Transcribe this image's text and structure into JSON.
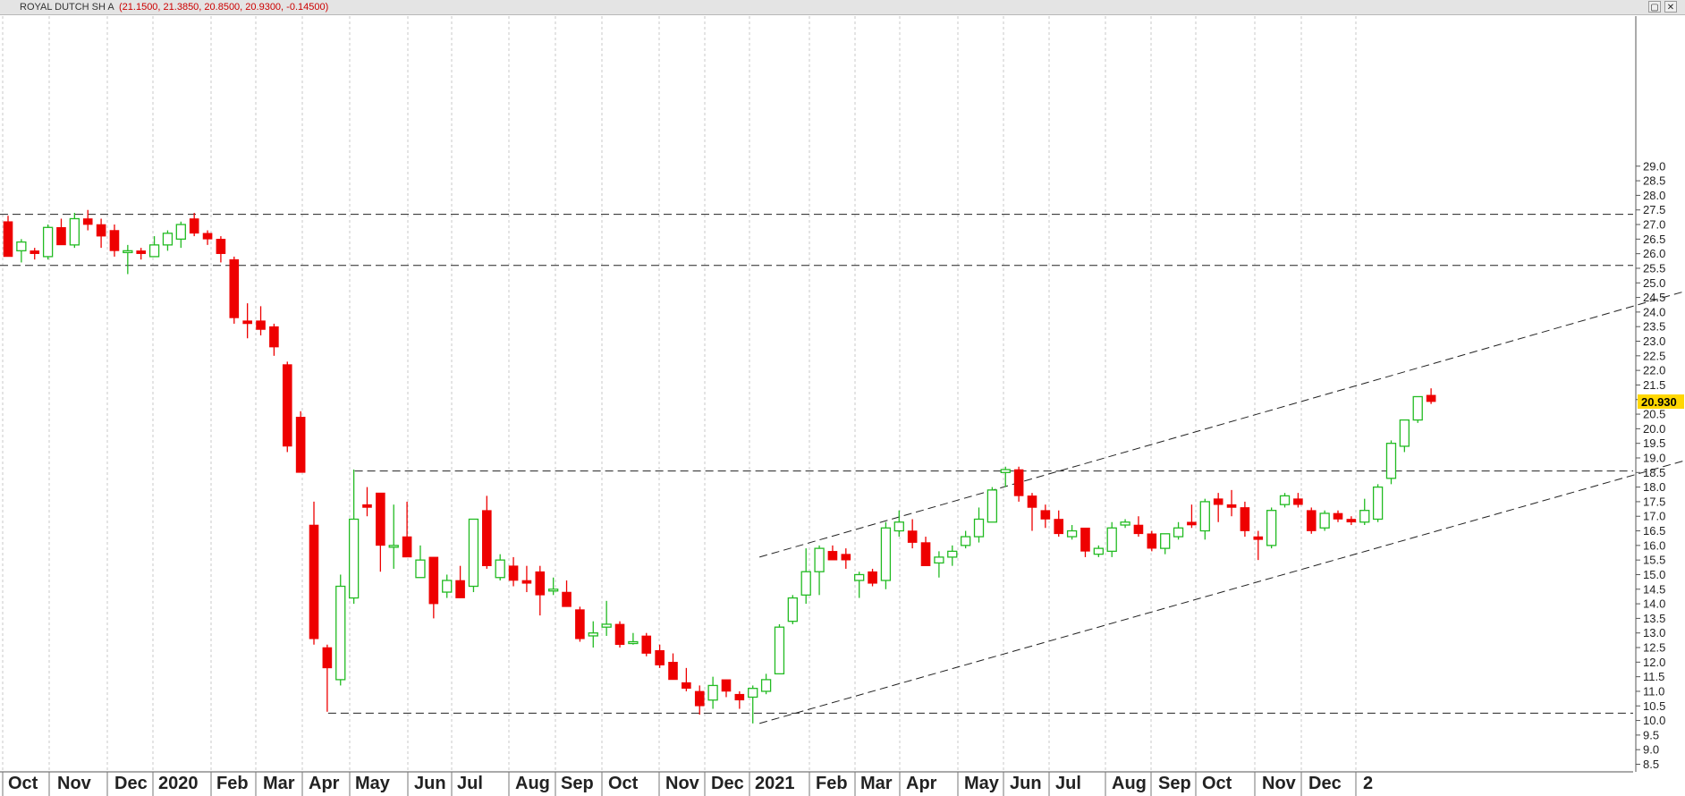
{
  "header": {
    "symbol": "ROYAL DUTCH SH A",
    "ohlc_text": "(21.1500, 21.3850, 20.8500, 20.9300, -0.14500)",
    "restore_icon": "restore-icon",
    "close_icon": "close-icon",
    "restore_glyph": "▢",
    "close_glyph": "✕"
  },
  "colors": {
    "up": "#22bb22",
    "down": "#ee0000",
    "grid": "#c8c8c8",
    "trendline": "#222222",
    "last_price_bg": "#ffd700"
  },
  "chart_data": {
    "type": "candlestick",
    "title": "ROYAL DUTCH SH A",
    "interval": "weekly",
    "ylim": [
      8.25,
      29.25
    ],
    "y_ticks": [
      "29.0",
      "28.5",
      "28.0",
      "27.5",
      "27.0",
      "26.5",
      "26.0",
      "25.5",
      "25.0",
      "24.5",
      "24.0",
      "23.5",
      "23.0",
      "22.5",
      "22.0",
      "21.5",
      "21.0",
      "20.5",
      "20.0",
      "19.5",
      "19.0",
      "18.5",
      "18.0",
      "17.5",
      "17.0",
      "16.5",
      "16.0",
      "15.5",
      "15.0",
      "14.5",
      "14.0",
      "13.5",
      "13.0",
      "12.5",
      "12.0",
      "11.5",
      "11.0",
      "10.5",
      "10.0",
      "9.5",
      "9.0",
      "8.5"
    ],
    "x_labels": [
      "Oct",
      "Nov",
      "Dec",
      "2020",
      "Feb",
      "Mar",
      "Apr",
      "May",
      "Jun",
      "Jul",
      "Aug",
      "Sep",
      "Oct",
      "Nov",
      "Dec",
      "2021",
      "Feb",
      "Mar",
      "Apr",
      "May",
      "Jun",
      "Jul",
      "Aug",
      "Sep",
      "Oct",
      "Nov",
      "Dec",
      "2"
    ],
    "last_price_label": "20.930",
    "grid": true,
    "candles": [
      {
        "o": 27.1,
        "h": 27.3,
        "l": 25.9,
        "c": 25.9
      },
      {
        "o": 26.1,
        "h": 26.5,
        "l": 25.7,
        "c": 26.4
      },
      {
        "o": 26.1,
        "h": 26.2,
        "l": 25.8,
        "c": 26.0
      },
      {
        "o": 25.9,
        "h": 27.0,
        "l": 25.8,
        "c": 26.9
      },
      {
        "o": 26.9,
        "h": 27.2,
        "l": 26.3,
        "c": 26.3
      },
      {
        "o": 26.3,
        "h": 27.4,
        "l": 26.2,
        "c": 27.2
      },
      {
        "o": 27.2,
        "h": 27.5,
        "l": 26.8,
        "c": 27.0
      },
      {
        "o": 27.0,
        "h": 27.2,
        "l": 26.2,
        "c": 26.6
      },
      {
        "o": 26.8,
        "h": 27.0,
        "l": 25.9,
        "c": 26.1
      },
      {
        "o": 26.1,
        "h": 26.3,
        "l": 25.3,
        "c": 26.1
      },
      {
        "o": 26.1,
        "h": 26.2,
        "l": 25.8,
        "c": 26.0
      },
      {
        "o": 25.9,
        "h": 26.6,
        "l": 25.9,
        "c": 26.3
      },
      {
        "o": 26.3,
        "h": 26.8,
        "l": 26.1,
        "c": 26.7
      },
      {
        "o": 26.5,
        "h": 27.1,
        "l": 26.2,
        "c": 27.0
      },
      {
        "o": 27.2,
        "h": 27.4,
        "l": 26.6,
        "c": 26.7
      },
      {
        "o": 26.7,
        "h": 26.8,
        "l": 26.3,
        "c": 26.5
      },
      {
        "o": 26.5,
        "h": 26.6,
        "l": 25.7,
        "c": 26.0
      },
      {
        "o": 25.8,
        "h": 25.9,
        "l": 23.6,
        "c": 23.8
      },
      {
        "o": 23.7,
        "h": 24.3,
        "l": 23.1,
        "c": 23.6
      },
      {
        "o": 23.7,
        "h": 24.2,
        "l": 23.2,
        "c": 23.4
      },
      {
        "o": 23.5,
        "h": 23.6,
        "l": 22.5,
        "c": 22.8
      },
      {
        "o": 22.2,
        "h": 22.3,
        "l": 19.2,
        "c": 19.4
      },
      {
        "o": 20.4,
        "h": 20.6,
        "l": 18.5,
        "c": 18.5
      },
      {
        "o": 16.7,
        "h": 17.5,
        "l": 12.6,
        "c": 12.8
      },
      {
        "o": 12.5,
        "h": 12.6,
        "l": 10.3,
        "c": 11.8
      },
      {
        "o": 11.4,
        "h": 15.0,
        "l": 11.2,
        "c": 14.6
      },
      {
        "o": 14.2,
        "h": 18.6,
        "l": 14.0,
        "c": 16.9
      },
      {
        "o": 17.4,
        "h": 18.0,
        "l": 17.0,
        "c": 17.3
      },
      {
        "o": 17.8,
        "h": 17.8,
        "l": 15.1,
        "c": 16.0
      },
      {
        "o": 16.0,
        "h": 17.4,
        "l": 15.2,
        "c": 16.0
      },
      {
        "o": 16.3,
        "h": 17.5,
        "l": 15.6,
        "c": 15.6
      },
      {
        "o": 14.9,
        "h": 16.0,
        "l": 14.9,
        "c": 15.5
      },
      {
        "o": 15.6,
        "h": 15.6,
        "l": 13.5,
        "c": 14.0
      },
      {
        "o": 14.4,
        "h": 15.0,
        "l": 14.2,
        "c": 14.8
      },
      {
        "o": 14.8,
        "h": 15.3,
        "l": 14.2,
        "c": 14.2
      },
      {
        "o": 14.6,
        "h": 16.9,
        "l": 14.4,
        "c": 16.9
      },
      {
        "o": 17.2,
        "h": 17.7,
        "l": 15.2,
        "c": 15.3
      },
      {
        "o": 14.9,
        "h": 15.7,
        "l": 14.8,
        "c": 15.5
      },
      {
        "o": 15.3,
        "h": 15.6,
        "l": 14.6,
        "c": 14.8
      },
      {
        "o": 14.8,
        "h": 15.3,
        "l": 14.4,
        "c": 14.7
      },
      {
        "o": 15.1,
        "h": 15.3,
        "l": 13.6,
        "c": 14.3
      },
      {
        "o": 14.5,
        "h": 14.9,
        "l": 14.3,
        "c": 14.5
      },
      {
        "o": 14.4,
        "h": 14.8,
        "l": 13.9,
        "c": 13.9
      },
      {
        "o": 13.8,
        "h": 13.9,
        "l": 12.7,
        "c": 12.8
      },
      {
        "o": 12.9,
        "h": 13.4,
        "l": 12.5,
        "c": 13.0
      },
      {
        "o": 13.2,
        "h": 14.1,
        "l": 12.9,
        "c": 13.3
      },
      {
        "o": 13.3,
        "h": 13.4,
        "l": 12.5,
        "c": 12.6
      },
      {
        "o": 12.7,
        "h": 13.0,
        "l": 12.6,
        "c": 12.7
      },
      {
        "o": 12.9,
        "h": 13.0,
        "l": 12.2,
        "c": 12.3
      },
      {
        "o": 12.4,
        "h": 12.6,
        "l": 11.8,
        "c": 11.9
      },
      {
        "o": 12.0,
        "h": 12.3,
        "l": 11.4,
        "c": 11.4
      },
      {
        "o": 11.3,
        "h": 11.8,
        "l": 11.0,
        "c": 11.1
      },
      {
        "o": 11.0,
        "h": 11.2,
        "l": 10.2,
        "c": 10.5
      },
      {
        "o": 10.7,
        "h": 11.5,
        "l": 10.4,
        "c": 11.2
      },
      {
        "o": 11.4,
        "h": 11.4,
        "l": 10.8,
        "c": 11.0
      },
      {
        "o": 10.9,
        "h": 11.0,
        "l": 10.4,
        "c": 10.7
      },
      {
        "o": 10.8,
        "h": 11.2,
        "l": 9.9,
        "c": 11.1
      },
      {
        "o": 11.0,
        "h": 11.6,
        "l": 10.9,
        "c": 11.4
      },
      {
        "o": 11.6,
        "h": 13.3,
        "l": 11.6,
        "c": 13.2
      },
      {
        "o": 13.4,
        "h": 14.3,
        "l": 13.3,
        "c": 14.2
      },
      {
        "o": 14.3,
        "h": 15.9,
        "l": 14.0,
        "c": 15.1
      },
      {
        "o": 15.1,
        "h": 16.0,
        "l": 14.3,
        "c": 15.9
      },
      {
        "o": 15.8,
        "h": 16.0,
        "l": 15.5,
        "c": 15.5
      },
      {
        "o": 15.7,
        "h": 15.9,
        "l": 15.2,
        "c": 15.5
      },
      {
        "o": 14.8,
        "h": 15.1,
        "l": 14.2,
        "c": 15.0
      },
      {
        "o": 15.1,
        "h": 15.2,
        "l": 14.6,
        "c": 14.7
      },
      {
        "o": 14.8,
        "h": 16.8,
        "l": 14.5,
        "c": 16.6
      },
      {
        "o": 16.5,
        "h": 17.2,
        "l": 16.3,
        "c": 16.8
      },
      {
        "o": 16.5,
        "h": 16.9,
        "l": 15.9,
        "c": 16.1
      },
      {
        "o": 16.1,
        "h": 16.3,
        "l": 15.3,
        "c": 15.3
      },
      {
        "o": 15.4,
        "h": 15.8,
        "l": 14.9,
        "c": 15.6
      },
      {
        "o": 15.6,
        "h": 16.0,
        "l": 15.3,
        "c": 15.8
      },
      {
        "o": 16.0,
        "h": 16.5,
        "l": 15.9,
        "c": 16.3
      },
      {
        "o": 16.3,
        "h": 17.3,
        "l": 16.1,
        "c": 16.9
      },
      {
        "o": 16.8,
        "h": 18.0,
        "l": 16.8,
        "c": 17.9
      },
      {
        "o": 18.5,
        "h": 18.7,
        "l": 18.0,
        "c": 18.6
      },
      {
        "o": 18.6,
        "h": 18.7,
        "l": 17.5,
        "c": 17.7
      },
      {
        "o": 17.7,
        "h": 17.8,
        "l": 16.5,
        "c": 17.3
      },
      {
        "o": 17.2,
        "h": 17.4,
        "l": 16.6,
        "c": 16.9
      },
      {
        "o": 16.9,
        "h": 17.2,
        "l": 16.3,
        "c": 16.4
      },
      {
        "o": 16.3,
        "h": 16.7,
        "l": 16.2,
        "c": 16.5
      },
      {
        "o": 16.6,
        "h": 16.6,
        "l": 15.6,
        "c": 15.8
      },
      {
        "o": 15.7,
        "h": 16.0,
        "l": 15.6,
        "c": 15.9
      },
      {
        "o": 15.8,
        "h": 16.8,
        "l": 15.6,
        "c": 16.6
      },
      {
        "o": 16.7,
        "h": 16.9,
        "l": 16.6,
        "c": 16.8
      },
      {
        "o": 16.7,
        "h": 17.0,
        "l": 16.3,
        "c": 16.4
      },
      {
        "o": 16.4,
        "h": 16.5,
        "l": 15.8,
        "c": 15.9
      },
      {
        "o": 15.9,
        "h": 16.4,
        "l": 15.7,
        "c": 16.4
      },
      {
        "o": 16.3,
        "h": 16.8,
        "l": 16.2,
        "c": 16.6
      },
      {
        "o": 16.8,
        "h": 17.4,
        "l": 16.6,
        "c": 16.7
      },
      {
        "o": 16.5,
        "h": 17.6,
        "l": 16.2,
        "c": 17.5
      },
      {
        "o": 17.6,
        "h": 17.8,
        "l": 16.8,
        "c": 17.4
      },
      {
        "o": 17.4,
        "h": 17.9,
        "l": 17.0,
        "c": 17.3
      },
      {
        "o": 17.3,
        "h": 17.5,
        "l": 16.3,
        "c": 16.5
      },
      {
        "o": 16.3,
        "h": 16.5,
        "l": 15.5,
        "c": 16.2
      },
      {
        "o": 16.0,
        "h": 17.3,
        "l": 15.9,
        "c": 17.2
      },
      {
        "o": 17.4,
        "h": 17.8,
        "l": 17.3,
        "c": 17.7
      },
      {
        "o": 17.6,
        "h": 17.8,
        "l": 17.3,
        "c": 17.4
      },
      {
        "o": 17.2,
        "h": 17.3,
        "l": 16.4,
        "c": 16.5
      },
      {
        "o": 16.6,
        "h": 17.2,
        "l": 16.5,
        "c": 17.1
      },
      {
        "o": 17.1,
        "h": 17.2,
        "l": 16.8,
        "c": 16.9
      },
      {
        "o": 16.9,
        "h": 17.0,
        "l": 16.7,
        "c": 16.8
      },
      {
        "o": 16.8,
        "h": 17.6,
        "l": 16.7,
        "c": 17.2
      },
      {
        "o": 16.9,
        "h": 18.1,
        "l": 16.8,
        "c": 18.0
      },
      {
        "o": 18.3,
        "h": 19.6,
        "l": 18.1,
        "c": 19.5
      },
      {
        "o": 19.4,
        "h": 20.3,
        "l": 19.2,
        "c": 20.3
      },
      {
        "o": 20.3,
        "h": 21.1,
        "l": 20.2,
        "c": 21.1
      },
      {
        "o": 21.15,
        "h": 21.385,
        "l": 20.85,
        "c": 20.93
      }
    ],
    "horizontal_levels": [
      {
        "y": 27.35,
        "start_index": 0
      },
      {
        "y": 25.6,
        "start_index": 0
      },
      {
        "y": 18.55,
        "start_index": 26
      },
      {
        "y": 10.25,
        "start_index": 24
      }
    ],
    "channel_lines": [
      {
        "x1": 56.5,
        "y1": 15.6,
        "x2": 126,
        "y2": 24.7
      },
      {
        "x1": 56.5,
        "y1": 9.9,
        "x2": 126,
        "y2": 18.9
      }
    ]
  }
}
